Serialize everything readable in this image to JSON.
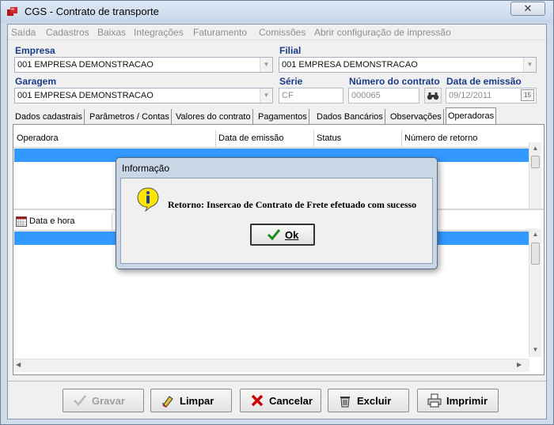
{
  "window": {
    "title": "CGS - Contrato de transporte",
    "close": "✕"
  },
  "menu": [
    "Saída",
    "Cadastros",
    "Baixas",
    "Integrações",
    "Faturamento",
    "Comissões",
    "Abrir configuração de impressão"
  ],
  "form": {
    "empresa_label": "Empresa",
    "empresa_value": "001 EMPRESA DEMONSTRACAO",
    "filial_label": "Filial",
    "filial_value": "001 EMPRESA DEMONSTRACAO",
    "garagem_label": "Garagem",
    "garagem_value": "001 EMPRESA DEMONSTRACAO",
    "serie_label": "Série",
    "serie_value": "CF",
    "numero_label": "Número do contrato",
    "numero_value": "000065",
    "data_label": "Data de emissão",
    "data_value": "09/12/2011",
    "calendar_glyph": "15"
  },
  "tabs": [
    "Dados cadastrais",
    "Parâmetros / Contas",
    "Valores do contrato",
    "Pagamentos",
    "Dados Bancários",
    "Observações",
    "Operadoras"
  ],
  "grid1": {
    "columns": [
      "Operadora",
      "Data de emissão",
      "Status",
      "Número de retorno"
    ]
  },
  "grid2": {
    "columns": [
      "Data e hora"
    ]
  },
  "toolbar": {
    "gravar": "Gravar",
    "limpar": "Limpar",
    "cancelar": "Cancelar",
    "excluir": "Excluir",
    "imprimir": "Imprimir"
  },
  "dialog": {
    "title": "Informação",
    "message": "Retorno: Insercao de Contrato de Frete efetuado com sucesso",
    "ok": "Ok"
  }
}
